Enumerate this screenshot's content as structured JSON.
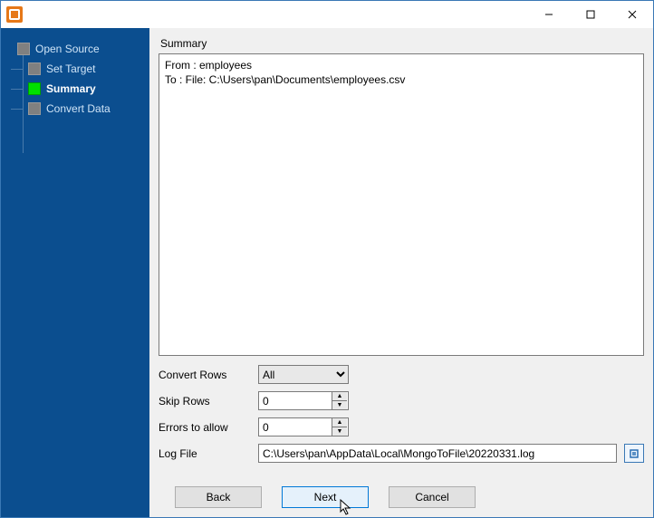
{
  "sidebar": {
    "items": [
      {
        "label": "Open Source",
        "active": false
      },
      {
        "label": "Set Target",
        "active": false
      },
      {
        "label": "Summary",
        "active": true
      },
      {
        "label": "Convert Data",
        "active": false
      }
    ]
  },
  "summary": {
    "title": "Summary",
    "text": "From : employees\nTo : File: C:\\Users\\pan\\Documents\\employees.csv"
  },
  "options": {
    "convert_rows": {
      "label": "Convert Rows",
      "value": "All",
      "options": [
        "All"
      ]
    },
    "skip_rows": {
      "label": "Skip Rows",
      "value": "0"
    },
    "errors": {
      "label": "Errors to allow",
      "value": "0"
    },
    "logfile": {
      "label": "Log File",
      "value": "C:\\Users\\pan\\AppData\\Local\\MongoToFile\\20220331.log"
    }
  },
  "buttons": {
    "back": "Back",
    "next": "Next",
    "cancel": "Cancel"
  }
}
